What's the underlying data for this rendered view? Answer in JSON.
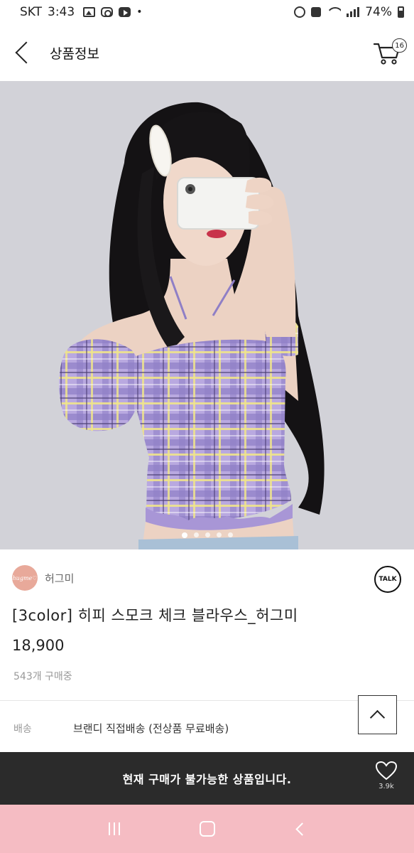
{
  "status_bar": {
    "carrier": "SKT",
    "time": "3:43",
    "notification_icons": [
      "gallery-icon",
      "instagram-icon",
      "youtube-icon"
    ],
    "dot": "•",
    "battery": "74%"
  },
  "header": {
    "title": "상품정보",
    "cart_count": "16"
  },
  "product_image": {
    "alt": "보라색 체크 스모크 블라우스를 입은 모델",
    "slide_count": 5,
    "active_slide": 1
  },
  "seller": {
    "name": "허그미",
    "avatar_text": "hugme♡"
  },
  "talk_button": {
    "label": "TALK"
  },
  "product": {
    "name": "[3color] 히피 스모크 체크 블라우스_허그미",
    "price": "18,900",
    "purchase_count": "543개 구매중"
  },
  "shipping": {
    "label": "배송",
    "value": "브랜디 직접배송 (전상품 무료배송)"
  },
  "purchase_bar": {
    "message": "현재 구매가 불가능한 상품입니다.",
    "like_count": "3.9k"
  },
  "colors": {
    "purchase_bar_bg": "#2b2b2b",
    "nav_bar_bg": "#f5bcc3",
    "avatar_bg": "#e8a99a"
  }
}
